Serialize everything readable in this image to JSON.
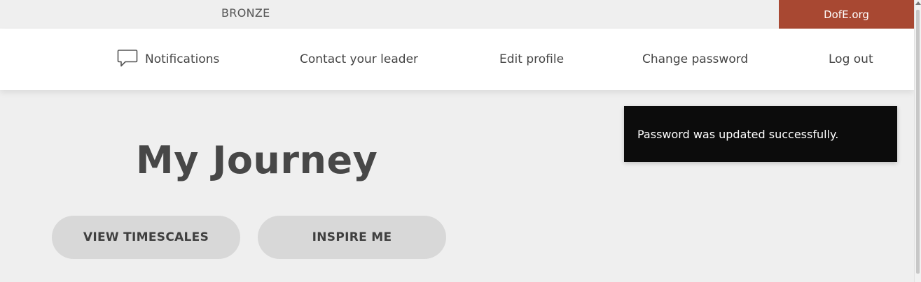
{
  "topbar": {
    "level": "BRONZE",
    "external_link": "DofE.org",
    "accent_color": "#a84832"
  },
  "nav": {
    "notifications": "Notifications",
    "notifications_icon": "speech-bubble-icon",
    "contact_leader": "Contact your leader",
    "edit_profile": "Edit profile",
    "change_password": "Change password",
    "log_out": "Log out"
  },
  "main": {
    "title": "My Journey",
    "buttons": {
      "view_timescales": "VIEW TIMESCALES",
      "inspire_me": "INSPIRE ME"
    }
  },
  "toast": {
    "message": "Password was updated successfully."
  }
}
